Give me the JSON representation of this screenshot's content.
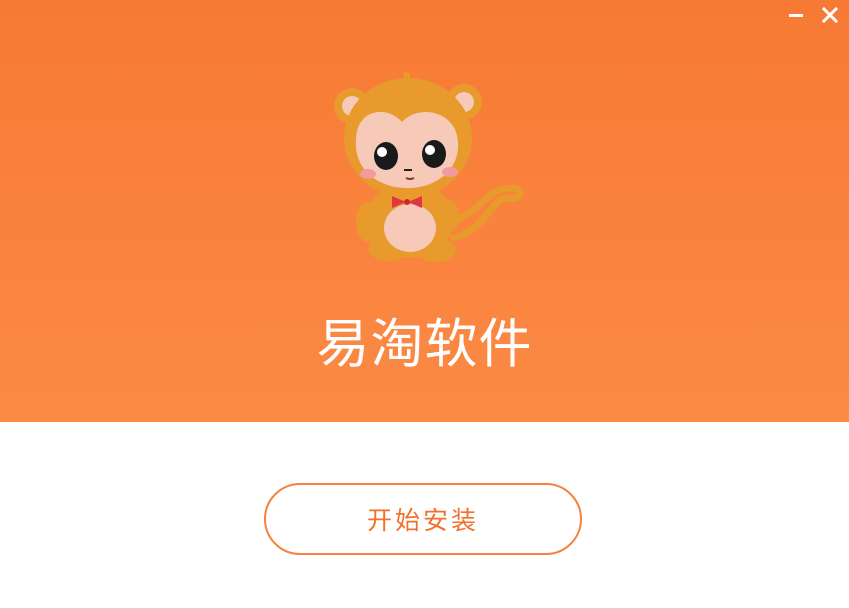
{
  "app": {
    "title": "易淘软件"
  },
  "window_controls": {
    "minimize_icon": "minimize-icon",
    "close_icon": "close-icon"
  },
  "logo": {
    "icon": "monkey-mascot-icon"
  },
  "install": {
    "label": "开始安装"
  },
  "colors": {
    "accent": "#f77a34",
    "accent_light": "#fb8a45",
    "button_text": "#f0712c",
    "background": "#ffffff"
  }
}
